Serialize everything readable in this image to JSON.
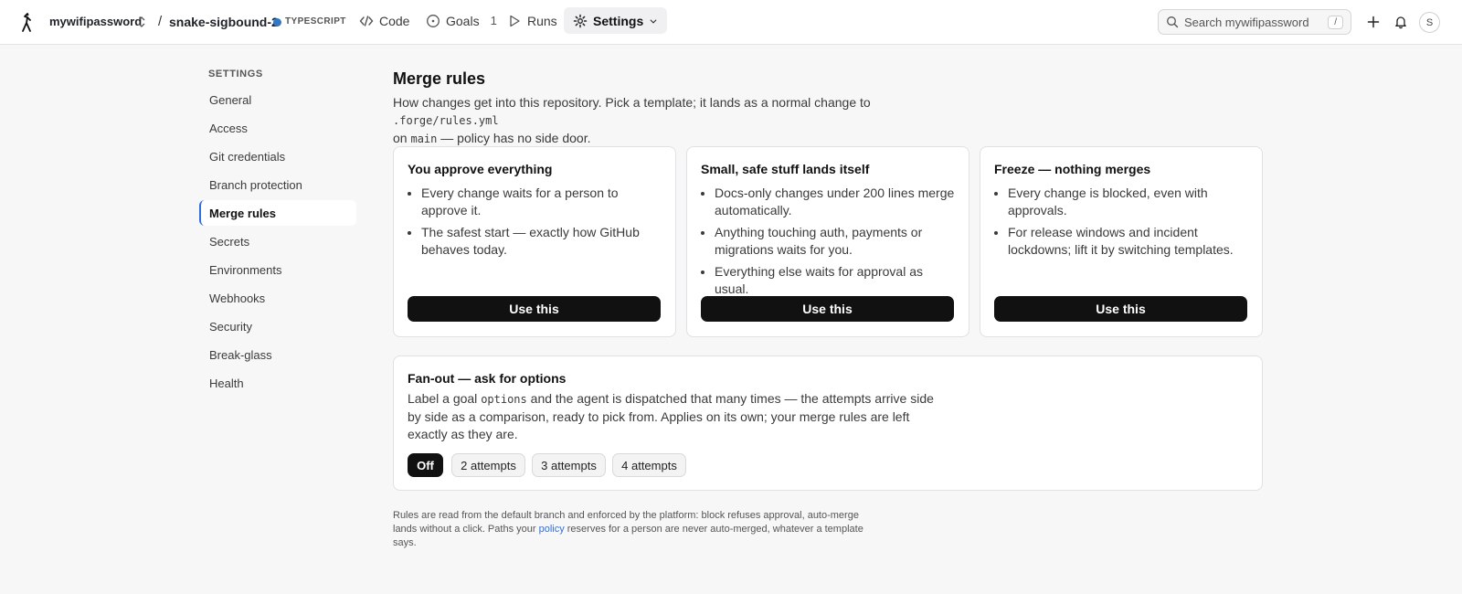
{
  "topbar": {
    "org": "mywifipassword",
    "separator": "/",
    "repo": "snake-sigbound-2",
    "language": "TYPESCRIPT",
    "nav": [
      {
        "label": "Code",
        "icon": "code-icon"
      },
      {
        "label": "Goals",
        "icon": "goal-circle-icon",
        "count": "1"
      },
      {
        "label": "Runs",
        "icon": "play-icon"
      },
      {
        "label": "Settings",
        "icon": "gear-icon",
        "active": true
      }
    ],
    "search_placeholder": "Search mywifipassword",
    "search_shortcut": "/",
    "avatar": "S"
  },
  "sidebar": {
    "heading": "SETTINGS",
    "items": [
      {
        "label": "General"
      },
      {
        "label": "Access"
      },
      {
        "label": "Git credentials"
      },
      {
        "label": "Branch protection"
      },
      {
        "label": "Merge rules",
        "active": true
      },
      {
        "label": "Secrets"
      },
      {
        "label": "Environments"
      },
      {
        "label": "Webhooks"
      },
      {
        "label": "Security"
      },
      {
        "label": "Break-glass"
      },
      {
        "label": "Health"
      }
    ]
  },
  "main": {
    "title": "Merge rules",
    "desc_1": "How changes get into this repository. Pick a template; it lands as a normal change to ",
    "desc_path": ".forge/rules.yml",
    "desc_2": "on ",
    "desc_branch": "main",
    "desc_3": " — policy has no side door.",
    "templates": [
      {
        "title": "You approve everything",
        "bullets": [
          "Every change waits for a person to approve it.",
          "The safest start — exactly how GitHub behaves today."
        ],
        "button": "Use this"
      },
      {
        "title": "Small, safe stuff lands itself",
        "bullets": [
          "Docs-only changes under 200 lines merge automatically.",
          "Anything touching auth, payments or migrations waits for you.",
          "Everything else waits for approval as usual."
        ],
        "button": "Use this"
      },
      {
        "title": "Freeze — nothing merges",
        "bullets": [
          "Every change is blocked, even with approvals.",
          "For release windows and incident lockdowns; lift it by switching templates."
        ],
        "button": "Use this"
      }
    ],
    "fanout": {
      "title": "Fan-out — ask for options",
      "text_1": "Label a goal ",
      "text_code": "options",
      "text_2": " and the agent is dispatched that many times — the attempts arrive side by side as a comparison, ready to pick from. Applies on its own; your merge rules are left exactly as they are.",
      "options": [
        "Off",
        "2 attempts",
        "3 attempts",
        "4 attempts"
      ],
      "selected": "Off"
    },
    "footnote_1": "Rules are read from the default branch and enforced by the platform: block refuses approval, auto-merge lands without a click. Paths your ",
    "footnote_link": "policy",
    "footnote_2": " reserves for a person are never auto-merged, whatever a template says.",
    "colors": {
      "accent": "#2f6fdb",
      "button": "#111111",
      "language_dot": "#3178c6"
    }
  }
}
